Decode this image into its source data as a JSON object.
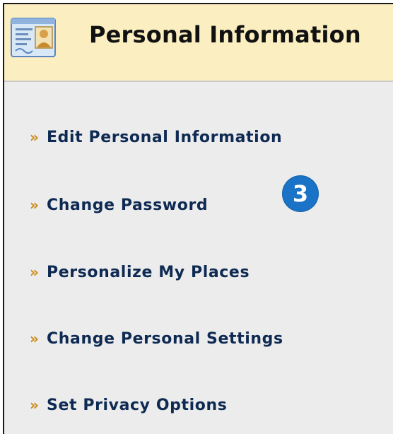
{
  "header": {
    "title": "Personal Information",
    "icon": "id-card-icon"
  },
  "menu": {
    "bullet": "»",
    "items": [
      {
        "label": "Edit Personal Information"
      },
      {
        "label": "Change Password"
      },
      {
        "label": "Personalize My Places"
      },
      {
        "label": "Change Personal Settings"
      },
      {
        "label": "Set Privacy Options"
      }
    ]
  },
  "badge": {
    "number": "3"
  },
  "colors": {
    "header_bg": "#fbeec1",
    "panel_bg": "#ececec",
    "link_text": "#0e2a52",
    "bullet": "#cc8a14",
    "badge_bg": "#1a73c6"
  }
}
